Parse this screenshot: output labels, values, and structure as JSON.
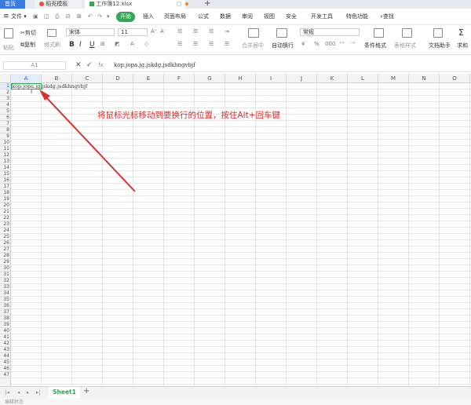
{
  "tabs": [
    {
      "label": "首页"
    },
    {
      "label": "稻壳模板"
    },
    {
      "label": "工作簿12.xlsx"
    }
  ],
  "new_tab_symbol": "+",
  "menu": {
    "file": "文件",
    "start": "开始",
    "items": [
      "插入",
      "页面布局",
      "公式",
      "数据",
      "审阅",
      "视图",
      "安全",
      "开发工具",
      "特色功能"
    ],
    "search": "查找"
  },
  "ribbon": {
    "paste": "粘贴",
    "cut": "剪切",
    "copy": "复制",
    "format_painter": "格式刷",
    "font_name": "宋体",
    "font_size": "11",
    "bold": "B",
    "italic": "I",
    "underline": "U",
    "merge_center": "合并居中",
    "wrap_text": "自动换行",
    "number_format": "常规",
    "currency": "¥",
    "percent": "%",
    "thousands": "000",
    "cond_format": "条件格式",
    "table_style": "表格样式",
    "doc_assistant": "文档助手",
    "sum": "求和"
  },
  "formula_bar": {
    "cell_ref": "A1",
    "fx": "fx",
    "content": "kop.jopa.jg.jskdg.jsdkhngvbjf"
  },
  "columns": [
    "A",
    "B",
    "C",
    "D",
    "E",
    "F",
    "G",
    "H",
    "I",
    "J",
    "K",
    "L",
    "M",
    "N",
    "O"
  ],
  "rows": [
    "1",
    "2",
    "3",
    "4",
    "5",
    "6",
    "7",
    "8",
    "9",
    "10",
    "11",
    "12",
    "13",
    "14",
    "15",
    "16",
    "17",
    "18",
    "19",
    "20",
    "21",
    "22",
    "23",
    "24",
    "25",
    "26",
    "27",
    "28",
    "29",
    "30",
    "31",
    "32",
    "33",
    "34",
    "35",
    "36",
    "37",
    "38",
    "39",
    "40",
    "41",
    "42",
    "43",
    "44",
    "45",
    "46",
    "47"
  ],
  "cell_a1": "kop.jopa.jg.jskdg.jsdkhngvbjf",
  "annotation": "将鼠标光标移动到要换行的位置，按住Alt+回车键",
  "annotation_color": "#d93030",
  "sheet_tab": "Sheet1",
  "add_sheet": "+",
  "status": "编辑状态",
  "accent": "#2fa84f"
}
